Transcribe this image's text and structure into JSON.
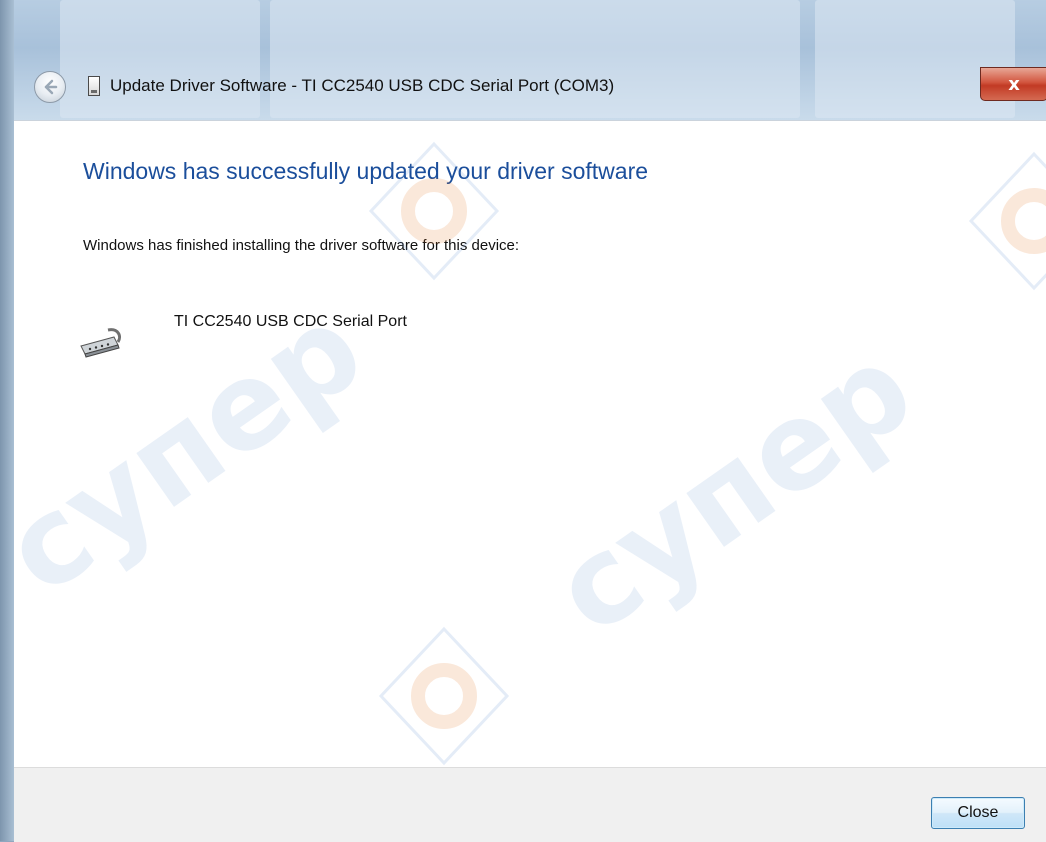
{
  "window": {
    "title": "Update Driver Software - TI CC2540 USB CDC Serial Port (COM3)",
    "close_glyph": "x"
  },
  "content": {
    "heading": "Windows has successfully updated your driver software",
    "subtext": "Windows has finished installing the driver software for this device:",
    "device_name": "TI CC2540 USB CDC Serial Port",
    "device_icon": "serial-port-icon"
  },
  "footer": {
    "close_label": "Close"
  },
  "watermark": {
    "text": "супер"
  },
  "colors": {
    "heading": "#1b4e9b",
    "close_button_border": "#3c7fb1",
    "title_close": "#c23a24"
  }
}
